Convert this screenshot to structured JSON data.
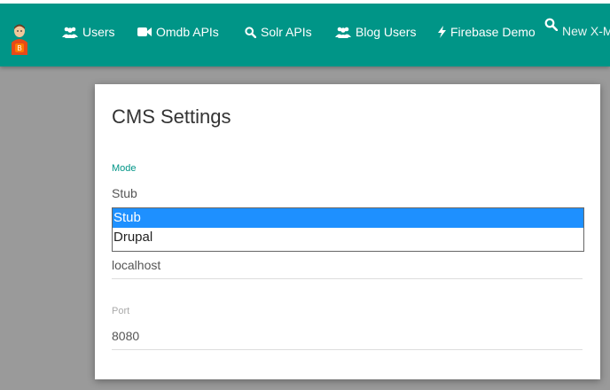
{
  "navbar": {
    "brand_icon": "blogger-avatar-icon",
    "items": [
      {
        "label": "Users",
        "icon": "users-icon"
      },
      {
        "label": "Omdb APIs",
        "icon": "video-camera-icon"
      },
      {
        "label": "Solr APIs",
        "icon": "search-icon"
      },
      {
        "label": "Blog Users",
        "icon": "users-icon"
      },
      {
        "label": "Firebase Demo",
        "icon": "bolt-icon"
      }
    ],
    "search": {
      "placeholder": "New X-Men",
      "icon": "search-icon"
    }
  },
  "card": {
    "title": "CMS Settings",
    "mode": {
      "label": "Mode",
      "value": "Stub",
      "options": [
        "Stub",
        "Drupal"
      ],
      "selected_option": "Stub"
    },
    "host": {
      "value": "localhost"
    },
    "port": {
      "label": "Port",
      "value": "8080"
    }
  },
  "colors": {
    "navbar": "#009587",
    "accent": "#009587",
    "selected_option": "#1e90ff",
    "backdrop": "#9a9a9a"
  }
}
